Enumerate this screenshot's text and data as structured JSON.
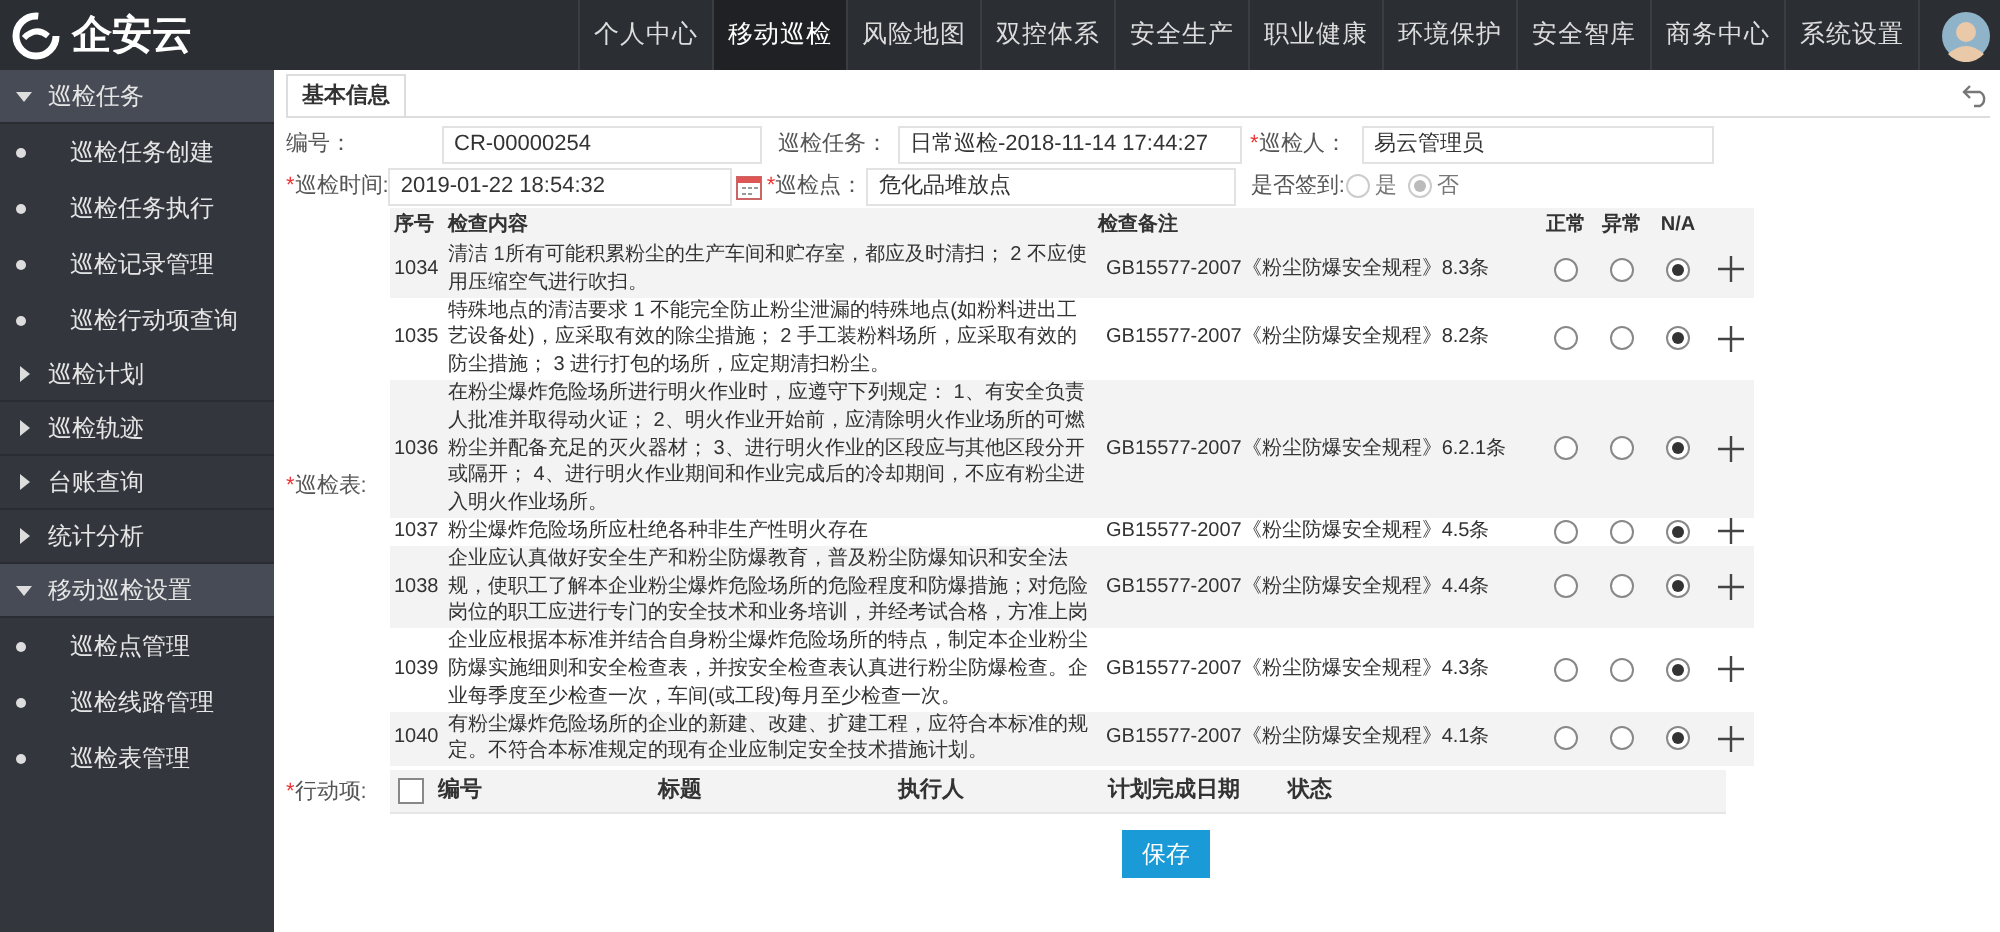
{
  "brand": {
    "name": "企安云"
  },
  "nav": [
    {
      "label": "个人中心",
      "selected": false
    },
    {
      "label": "移动巡检",
      "selected": true
    },
    {
      "label": "风险地图",
      "selected": false
    },
    {
      "label": "双控体系",
      "selected": false
    },
    {
      "label": "安全生产",
      "selected": false
    },
    {
      "label": "职业健康",
      "selected": false
    },
    {
      "label": "环境保护",
      "selected": false
    },
    {
      "label": "安全智库",
      "selected": false
    },
    {
      "label": "商务中心",
      "selected": false
    },
    {
      "label": "系统设置",
      "selected": false
    }
  ],
  "sidebar": [
    {
      "label": "巡检任务",
      "expanded": true,
      "children": [
        {
          "label": "巡检任务创建"
        },
        {
          "label": "巡检任务执行"
        },
        {
          "label": "巡检记录管理"
        },
        {
          "label": "巡检行动项查询"
        }
      ]
    },
    {
      "label": "巡检计划",
      "expanded": false
    },
    {
      "label": "巡检轨迹",
      "expanded": false
    },
    {
      "label": "台账查询",
      "expanded": false
    },
    {
      "label": "统计分析",
      "expanded": false
    },
    {
      "label": "移动巡检设置",
      "expanded": true,
      "children": [
        {
          "label": "巡检点管理"
        },
        {
          "label": "巡检线路管理"
        },
        {
          "label": "巡检表管理"
        }
      ]
    }
  ],
  "tabs": [
    {
      "label": "基本信息",
      "selected": true
    }
  ],
  "form": {
    "code": {
      "label": "编号：",
      "value": "CR-00000254"
    },
    "task": {
      "label": "巡检任务：",
      "value": "日常巡检-2018-11-14 17:44:27"
    },
    "inspector": {
      "required_mark": "*",
      "label": "巡检人：",
      "value": "易云管理员"
    },
    "time": {
      "required_mark": "*",
      "label": "巡检时间:",
      "value": "2019-01-22 18:54:32"
    },
    "point": {
      "required_mark": "*",
      "label": "巡检点：",
      "value": "危化品堆放点"
    },
    "signed": {
      "label": "是否签到:",
      "disabled": true,
      "options": [
        {
          "label": "是",
          "selected": false
        },
        {
          "label": "否",
          "selected": true
        }
      ]
    }
  },
  "checklist": {
    "required_mark": "*",
    "label": "巡检表:",
    "columns": [
      "序号",
      "检查内容",
      "检查备注",
      "正常",
      "异常",
      "N/A"
    ],
    "rows": [
      {
        "no": "1034",
        "content": "清洁 1所有可能积累粉尘的生产车间和贮存室，都应及时清扫； 2 不应使用压缩空气进行吹扫。",
        "note": "GB15577-2007《粉尘防爆安全规程》8.3条",
        "normal": false,
        "abnormal": false,
        "na": true
      },
      {
        "no": "1035",
        "content": "特殊地点的清洁要求 1 不能完全防止粉尘泄漏的特殊地点(如粉料进出工艺设备处)，应采取有效的除尘措施； 2 手工装粉料场所，应采取有效的防尘措施； 3 进行打包的场所，应定期清扫粉尘。",
        "note": "GB15577-2007《粉尘防爆安全规程》8.2条",
        "normal": false,
        "abnormal": false,
        "na": true
      },
      {
        "no": "1036",
        "content": "在粉尘爆炸危险场所进行明火作业时，应遵守下列规定： 1、有安全负责人批准并取得动火证； 2、明火作业开始前，应清除明火作业场所的可燃粉尘并配备充足的灭火器材； 3、进行明火作业的区段应与其他区段分开或隔开； 4、进行明火作业期间和作业完成后的冷却期间，不应有粉尘进入明火作业场所。",
        "note": "GB15577-2007《粉尘防爆安全规程》6.2.1条",
        "normal": false,
        "abnormal": false,
        "na": true
      },
      {
        "no": "1037",
        "content": "粉尘爆炸危险场所应杜绝各种非生产性明火存在",
        "note": "GB15577-2007《粉尘防爆安全规程》4.5条",
        "normal": false,
        "abnormal": false,
        "na": true
      },
      {
        "no": "1038",
        "content": "企业应认真做好安全生产和粉尘防爆教育，普及粉尘防爆知识和安全法规，使职工了解本企业粉尘爆炸危险场所的危险程度和防爆措施；对危险岗位的职工应进行专门的安全技术和业务培训，并经考试合格，方准上岗",
        "note": "GB15577-2007《粉尘防爆安全规程》4.4条",
        "normal": false,
        "abnormal": false,
        "na": true
      },
      {
        "no": "1039",
        "content": "企业应根据本标准并结合自身粉尘爆炸危险场所的特点，制定本企业粉尘防爆实施细则和安全检查表，并按安全检查表认真进行粉尘防爆检查。企业每季度至少检查一次，车间(或工段)每月至少检查一次。",
        "note": "GB15577-2007《粉尘防爆安全规程》4.3条",
        "normal": false,
        "abnormal": false,
        "na": true
      },
      {
        "no": "1040",
        "content": "有粉尘爆炸危险场所的企业的新建、改建、扩建工程，应符合本标准的规定。不符合本标准规定的现有企业应制定安全技术措施计划。",
        "note": "GB15577-2007《粉尘防爆安全规程》4.1条",
        "normal": false,
        "abnormal": false,
        "na": true
      }
    ]
  },
  "actions": {
    "required_mark": "*",
    "label": "行动项:",
    "select_all": {
      "checked": false
    },
    "columns": [
      "编号",
      "标题",
      "执行人",
      "计划完成日期",
      "状态"
    ]
  },
  "save_button": "保存"
}
